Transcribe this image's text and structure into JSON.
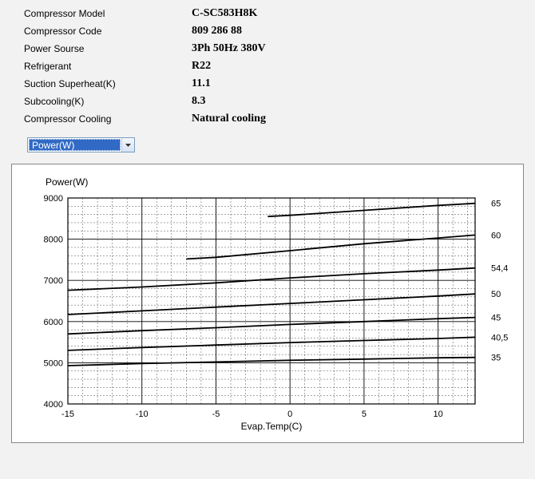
{
  "specs": {
    "rows": [
      {
        "label": "Compressor Model",
        "value": "C-SC583H8K"
      },
      {
        "label": "Compressor Code",
        "value": "809 286 88"
      },
      {
        "label": "Power Sourse",
        "value": "3Ph  50Hz  380V"
      },
      {
        "label": "Refrigerant",
        "value": "R22"
      },
      {
        "label": "Suction Superheat(K)",
        "value": "11.1"
      },
      {
        "label": "Subcooling(K)",
        "value": "8.3"
      },
      {
        "label": "Compressor Cooling",
        "value": "Natural cooling"
      }
    ]
  },
  "dropdown": {
    "selected": "Power(W)"
  },
  "chart_data": {
    "type": "line",
    "title": "Power(W)",
    "xlabel": "Evap.Temp(C)",
    "ylabel": "",
    "xlim": [
      -15,
      12.5
    ],
    "ylim": [
      4000,
      9000
    ],
    "y_ticks": [
      4000,
      5000,
      6000,
      7000,
      8000,
      9000
    ],
    "x_ticks": [
      -15,
      -10,
      -5,
      0,
      5,
      10
    ],
    "legend_label_header": "",
    "series": [
      {
        "name": "65",
        "x": [
          -1.5,
          0,
          5,
          10,
          12.5
        ],
        "y": [
          8550,
          8580,
          8700,
          8820,
          8870
        ]
      },
      {
        "name": "60",
        "x": [
          -7,
          -5,
          0,
          5,
          10,
          12.5
        ],
        "y": [
          7520,
          7560,
          7720,
          7890,
          8030,
          8100
        ]
      },
      {
        "name": "54,4",
        "x": [
          -15,
          -10,
          -5,
          0,
          5,
          10,
          12.5
        ],
        "y": [
          6760,
          6840,
          6940,
          7060,
          7160,
          7250,
          7300
        ]
      },
      {
        "name": "50",
        "x": [
          -15,
          -10,
          -5,
          0,
          5,
          10,
          12.5
        ],
        "y": [
          6170,
          6260,
          6350,
          6440,
          6530,
          6620,
          6670
        ]
      },
      {
        "name": "45",
        "x": [
          -15,
          -10,
          -5,
          0,
          5,
          10,
          12.5
        ],
        "y": [
          5700,
          5780,
          5850,
          5930,
          6000,
          6070,
          6100
        ]
      },
      {
        "name": "40,5",
        "x": [
          -15,
          -10,
          -5,
          0,
          5,
          10,
          12.5
        ],
        "y": [
          5300,
          5370,
          5430,
          5490,
          5540,
          5590,
          5620
        ]
      },
      {
        "name": "35",
        "x": [
          -15,
          -10,
          -5,
          0,
          5,
          10,
          12.5
        ],
        "y": [
          4930,
          4980,
          5020,
          5060,
          5090,
          5120,
          5130
        ]
      }
    ]
  }
}
